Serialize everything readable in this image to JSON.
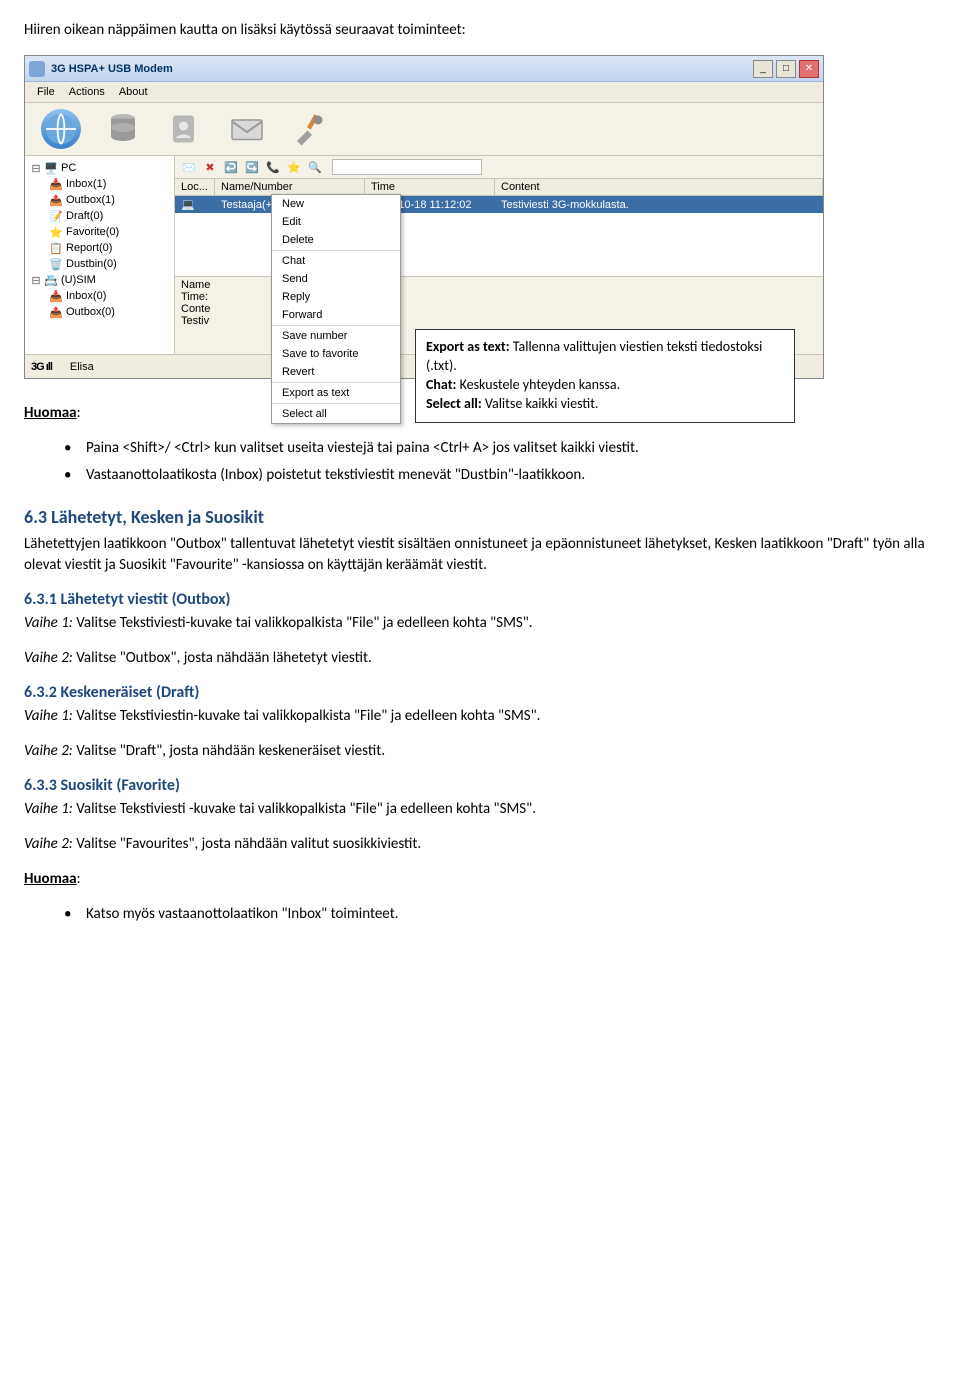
{
  "intro": "Hiiren oikean näppäimen kautta on lisäksi käytössä seuraavat toiminteet:",
  "screenshot": {
    "title": "3G HSPA+ USB Modem",
    "menubar": {
      "file": "File",
      "actions": "Actions",
      "about": "About"
    },
    "tree": {
      "pc": "PC",
      "items": [
        "Inbox(1)",
        "Outbox(1)",
        "Draft(0)",
        "Favorite(0)",
        "Report(0)",
        "Dustbin(0)"
      ],
      "sim": "(U)SIM",
      "simItems": [
        "Inbox(0)",
        "Outbox(0)"
      ]
    },
    "listHeader": {
      "loc": "Loc...",
      "name": "Name/Number",
      "time": "Time",
      "content": "Content"
    },
    "row": {
      "name": "Testaaja(+358...",
      "time": "2011-10-18 11:12:02",
      "content": "Testiviesti 3G-mokkulasta."
    },
    "context": {
      "items": [
        "New",
        "Edit",
        "Delete",
        "Chat",
        "Send",
        "Reply",
        "Forward",
        "Save number",
        "Save to favorite",
        "Revert",
        "Export as text",
        "Select all"
      ]
    },
    "detailLabels": {
      "name": "Name",
      "time": "Time:",
      "conte": "Conte",
      "testiv": "Testiv"
    },
    "annot": {
      "l1b": "Export as text:",
      "l1": " Tallenna valittujen viestien teksti tiedostoksi (.txt).",
      "l2b": "Chat:",
      "l2": " Keskustele yhteyden kanssa.",
      "l3b": "Select all:",
      "l3": " Valitse kaikki viestit."
    },
    "status": {
      "sig": "3G ıll",
      "carrier": "Elisa"
    }
  },
  "note": "Huomaa",
  "bullets1": {
    "a": "Paina <Shift>/ <Ctrl> kun valitset useita viestejä tai paina <Ctrl+ A> jos valitset kaikki viestit.",
    "b": "Vastaanottolaatikosta (Inbox) poistetut tekstiviestit menevät \"Dustbin\"-laatikkoon."
  },
  "s63": {
    "h": "6.3 Lähetetyt, Kesken ja Suosikit",
    "p": "Lähetettyjen laatikkoon \"Outbox\" tallentuvat lähetetyt viestit sisältäen onnistuneet ja epäonnistuneet lähetykset, Kesken laatikkoon \"Draft\" työn alla olevat viestit ja Suosikit \"Favourite\" -kansiossa on käyttäjän keräämät viestit."
  },
  "s631": {
    "h": "6.3.1 Lähetetyt viestit (Outbox)",
    "v1i": "Vaihe 1:",
    "v1": " Valitse Tekstiviesti-kuvake tai valikkopalkista \"File\" ja edelleen kohta \"SMS\".",
    "v2i": "Vaihe 2:",
    "v2": " Valitse \"Outbox\", josta nähdään lähetetyt viestit."
  },
  "s632": {
    "h": "6.3.2 Keskeneräiset (Draft)",
    "v1i": "Vaihe 1:",
    "v1": " Valitse Tekstiviestin-kuvake tai valikkopalkista \"File\" ja edelleen kohta \"SMS\".",
    "v2i": "Vaihe 2:",
    "v2": " Valitse \"Draft\", josta nähdään keskeneräiset viestit."
  },
  "s633": {
    "h": "6.3.3 Suosikit (Favorite)",
    "v1i": "Vaihe 1:",
    "v1": " Valitse Tekstiviesti -kuvake tai valikkopalkista \"File\" ja edelleen kohta \"SMS\".",
    "v2i": "Vaihe 2:",
    "v2": " Valitse \"Favourites\", josta nähdään valitut suosikkiviestit."
  },
  "lastBullet": "Katso myös vastaanottolaatikon \"Inbox\" toiminteet."
}
